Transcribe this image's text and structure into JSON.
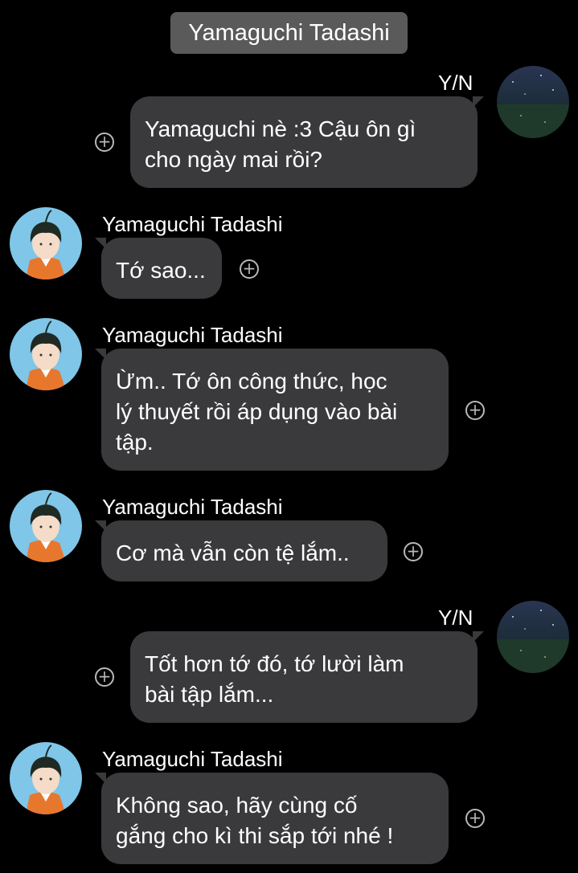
{
  "header": {
    "title": "Yamaguchi Tadashi"
  },
  "colors": {
    "background": "#000000",
    "bubble": "#3a3a3c",
    "header": "#5a5a5a",
    "avatar_bg": "#7fc6e8"
  },
  "messages": [
    {
      "side": "right",
      "sender": "Y/N",
      "lines": [
        "Yamaguchi nè :3 Cậu ôn gì",
        "cho ngày mai rồi?"
      ],
      "avatar": "night-sky-avatar"
    },
    {
      "side": "left",
      "sender": "Yamaguchi Tadashi",
      "lines": [
        "Tớ sao..."
      ],
      "avatar": "yamaguchi-avatar"
    },
    {
      "side": "left",
      "sender": "Yamaguchi Tadashi",
      "lines": [
        "Ừm.. Tớ ôn công thức, học",
        "lý thuyết rồi áp dụng vào bài",
        "tập."
      ],
      "avatar": "yamaguchi-avatar"
    },
    {
      "side": "left",
      "sender": "Yamaguchi Tadashi",
      "lines": [
        "Cơ mà vẫn còn tệ lắm.."
      ],
      "avatar": "yamaguchi-avatar"
    },
    {
      "side": "right",
      "sender": "Y/N",
      "lines": [
        "Tốt hơn tớ đó, tớ lười làm",
        "bài tập lắm..."
      ],
      "avatar": "night-sky-avatar"
    },
    {
      "side": "left",
      "sender": "Yamaguchi Tadashi",
      "lines": [
        "Không sao, hãy cùng cố",
        "gắng cho kì thi sắp tới nhé !"
      ],
      "avatar": "yamaguchi-avatar"
    }
  ]
}
